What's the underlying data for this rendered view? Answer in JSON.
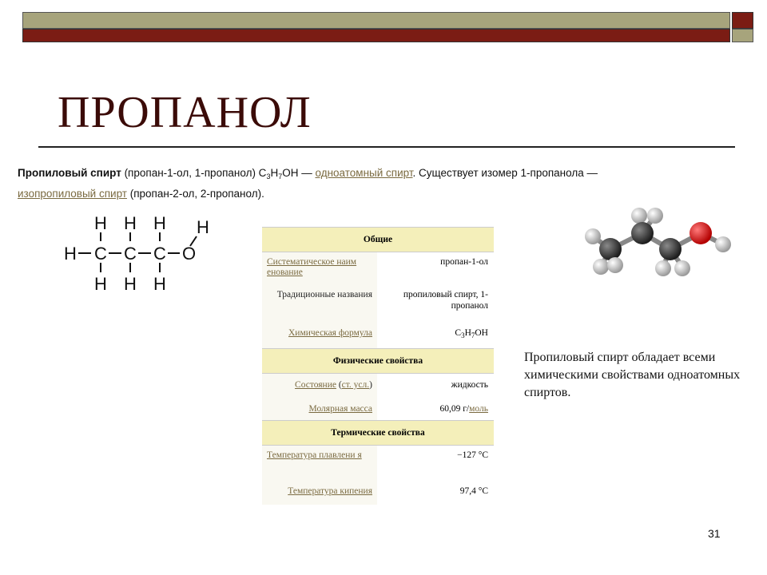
{
  "slide": {
    "title": "ПРОПАНОЛ",
    "page_number": "31",
    "colors": {
      "title": "#3b0b08",
      "bar_olive": "#a7a47c",
      "bar_red": "#7b1c14",
      "link": "#7a6a40",
      "section_bg": "#f4efba"
    }
  },
  "intro": {
    "bold": "Пропиловый спирт",
    "part1": " (пропан-1-ол, 1-пропанол) C",
    "sub1": "3",
    "part2": "H",
    "sub2": "7",
    "part3": "OH — ",
    "link1": "одноатомный спирт",
    "part4": ". Существует изомер 1-пропанола —",
    "link2": "изопропиловый спирт",
    "part5": " (пропан-2-ол, 2-пропанол)."
  },
  "structure": {
    "H": "H",
    "C": "C",
    "O": "O",
    "bond_h": "—",
    "bond_v": "|"
  },
  "infobox": {
    "sec_general": "Общие",
    "sys_name_label": "Систематическое наим енование",
    "sys_name_value": "пропан-1-ол",
    "trad_label": "Традиционные названия",
    "trad_value": "пропиловый спирт, 1-пропанол",
    "formula_label": "Химическая формула",
    "formula_c": "C",
    "formula_c_sub": "3",
    "formula_h": "H",
    "formula_h_sub": "7",
    "formula_oh": "OH",
    "sec_physical": "Физические свойства",
    "state_label": "Состояние",
    "state_paren_open": " (",
    "state_link": "ст. усл.",
    "state_paren_close": ")",
    "state_value": "жидкость",
    "molar_label": "Молярная масса",
    "molar_value": "60,09 г/",
    "molar_unit_link": "моль",
    "sec_thermal": "Термические свойства",
    "melt_label": "Температура плавлени я",
    "melt_value": "−127 °C",
    "boil_label": "Температура кипения",
    "boil_value": "97,4 °C"
  },
  "description": "Пропиловый спирт обладает всеми химическими свойствами одноатомных спиртов."
}
